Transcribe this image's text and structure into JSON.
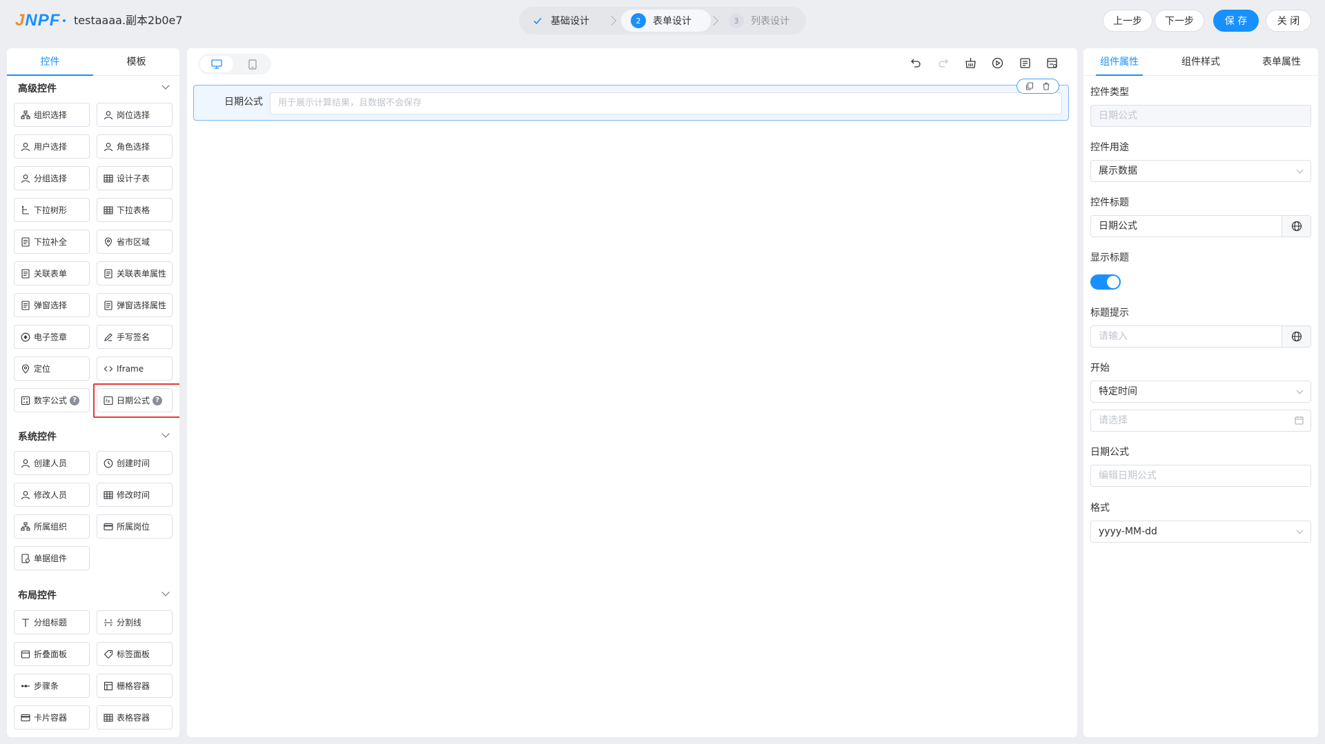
{
  "header": {
    "logo": {
      "j": "J",
      "rest": "NPF"
    },
    "title": "testaaaa.副本2b0e7",
    "steps": [
      {
        "label": "基础设计",
        "state": "done"
      },
      {
        "label": "表单设计",
        "state": "active",
        "num": "2"
      },
      {
        "label": "列表设计",
        "state": "todo",
        "num": "3"
      }
    ],
    "buttons": {
      "prev": "上一步",
      "next": "下一步",
      "save": "保 存",
      "close": "关 闭"
    }
  },
  "left": {
    "tabs": [
      "控件",
      "模板"
    ],
    "groups": [
      {
        "title": "高级控件",
        "items": [
          "组织选择",
          "岗位选择",
          "用户选择",
          "角色选择",
          "分组选择",
          "设计子表",
          "下拉树形",
          "下拉表格",
          "下拉补全",
          "省市区域",
          "关联表单",
          "关联表单属性",
          "弹窗选择",
          "弹窗选择属性",
          "电子签章",
          "手写签名",
          "定位",
          "Iframe",
          "数字公式",
          "日期公式"
        ]
      },
      {
        "title": "系统控件",
        "items": [
          "创建人员",
          "创建时间",
          "修改人员",
          "修改时间",
          "所属组织",
          "所属岗位",
          "单据组件"
        ]
      },
      {
        "title": "布局控件",
        "items": [
          "分组标题",
          "分割线",
          "折叠面板",
          "标签面板",
          "步骤条",
          "栅格容器",
          "卡片容器",
          "表格容器"
        ]
      }
    ],
    "help_mark": "?"
  },
  "canvas": {
    "field": {
      "label": "日期公式",
      "placeholder": "用于展示计算结果，且数据不会保存"
    }
  },
  "right": {
    "tabs": [
      "组件属性",
      "组件样式",
      "表单属性"
    ],
    "props": {
      "type_label": "控件类型",
      "type_value": "日期公式",
      "usage_label": "控件用途",
      "usage_value": "展示数据",
      "title_label": "控件标题",
      "title_value": "日期公式",
      "show_title_label": "显示标题",
      "show_title": true,
      "tip_label": "标题提示",
      "tip_placeholder": "请输入",
      "start_label": "开始",
      "start_value": "特定时间",
      "start_date_placeholder": "请选择",
      "formula_label": "日期公式",
      "formula_placeholder": "编辑日期公式",
      "format_label": "格式",
      "format_value": "yyyy-MM-dd"
    }
  },
  "colors": {
    "primary": "#1890ff",
    "logo_accent": "#f28c28",
    "highlight": "#e53935"
  }
}
